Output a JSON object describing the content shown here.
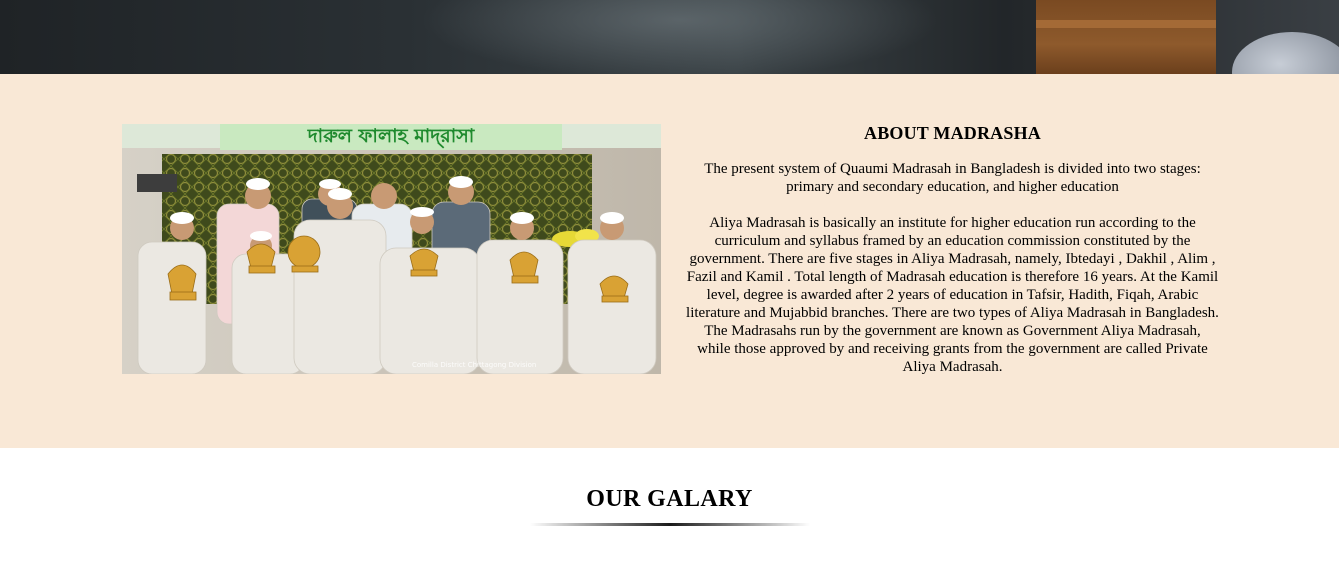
{
  "about": {
    "title": "ABOUT MADRASHA",
    "paragraph1": "The present system of Quaumi Madrasah in Bangladesh is divided into two stages: primary and secondary education, and higher education",
    "paragraph2": "Aliya Madrasah is basically an institute for higher education run according to the curriculum and syllabus framed by an education commission constituted by the government. There are five stages in Aliya Madrasah, namely, Ibtedayi , Dakhil , Alim , Fazil and Kamil . Total length of Madrasah education is therefore 16 years. At the Kamil level, degree is awarded after 2 years of education in Tafsir, Hadith, Fiqah, Arabic literature and Mujabbid branches. There are two types of Aliya Madrasah in Bangladesh. The Madrasahs run by the government are known as Government Aliya Madrasah, while those approved by and receiving grants from the government are called Private Aliya Madrasah.",
    "photo": {
      "banner_text": "দারুল ফালাহ মাদ্‌রাসা",
      "caption": "Comilla District Chittagong Division"
    }
  },
  "gallery": {
    "title": "OUR GALARY"
  },
  "colors": {
    "about_bg": "#f9e8d6",
    "banner_green": "#2e9a3a"
  }
}
